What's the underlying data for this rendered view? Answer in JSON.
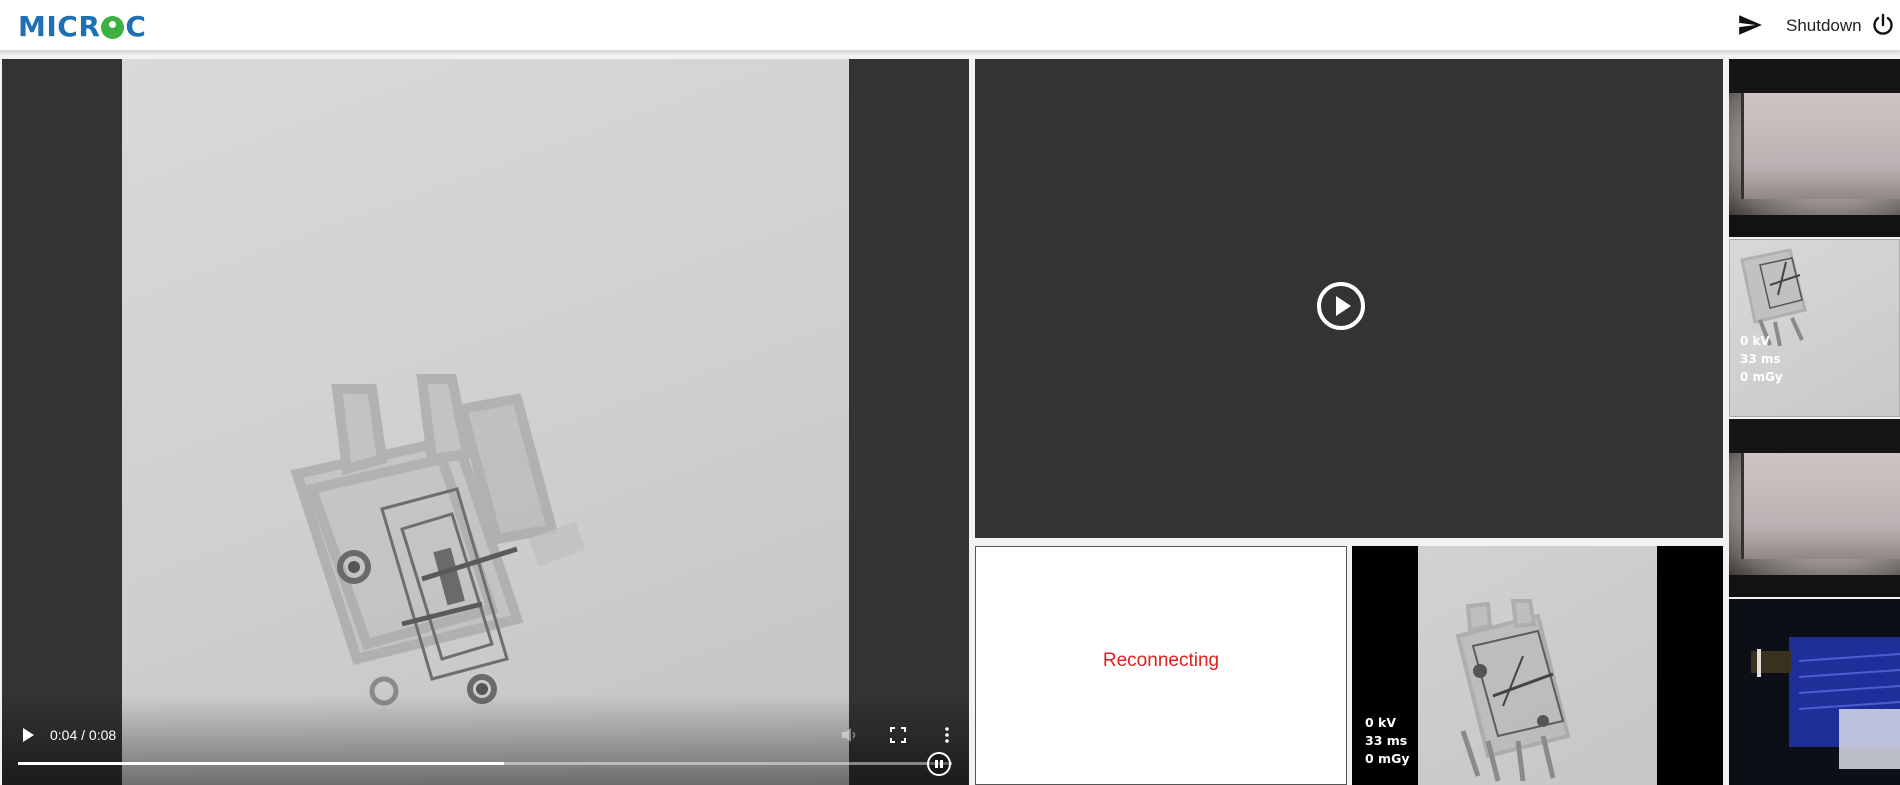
{
  "header": {
    "logo_text": "MICROC",
    "logo_left": "MICR",
    "logo_right": "C",
    "shutdown_label": "Shutdown",
    "accent_color": "#1f6fb5",
    "logo_green": "#3cb043"
  },
  "main_video": {
    "time_display": "0:04 / 0:08",
    "progress": 0.52
  },
  "reconnect_panel": {
    "status_text": "Reconnecting",
    "status_color": "#e01e1e"
  },
  "xray_panel": {
    "kv": "0 kV",
    "ms": "33 ms",
    "mgy": "0 mGy"
  },
  "thumbnails": [
    {
      "kind": "camera"
    },
    {
      "kind": "xray",
      "kv": "0 kV",
      "ms": "33 ms",
      "mgy": "0 mGy"
    },
    {
      "kind": "camera"
    },
    {
      "kind": "camera-dark"
    }
  ]
}
